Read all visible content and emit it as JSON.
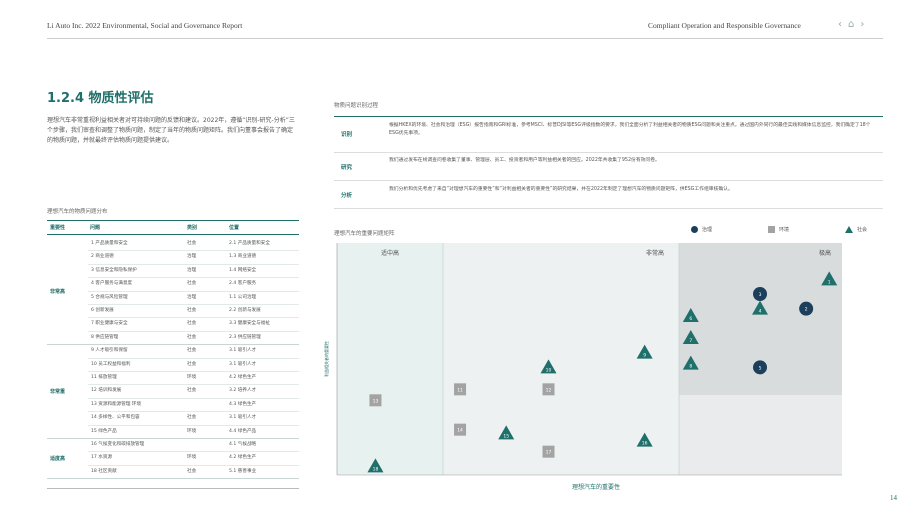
{
  "header": {
    "left": "Li Auto Inc. 2022 Environmental, Social and Governance Report",
    "right": "Compliant Operation and Responsible Governance",
    "nav": {
      "prev": "‹",
      "home": "⌂",
      "next": "›"
    }
  },
  "section": {
    "title": "1.2.4 物质性评估",
    "intro": "理想汽车非常重视利益相关者对可持续问题的反馈和建议。2022年，遵循“识别-研究-分析”三个步骤，我们审查和调整了物质问题，制定了当年的物质问题矩阵。我们向董事会报告了确定的物质问题，并就最终评估物质问题提供建议。"
  },
  "materiality_table": {
    "caption": "理想汽车的物质问题分布",
    "headers": [
      "重要性",
      "问题",
      "类别",
      "位置"
    ],
    "groups": [
      {
        "label": "非常高",
        "rows": [
          [
            "1  产品质量和安全",
            "社会",
            "2.1  产品质量和安全"
          ],
          [
            "2  商业道德",
            "治理",
            "1.3  商业道德"
          ],
          [
            "3  信息安全和隐私保护",
            "治理",
            "1.4  网络安全"
          ],
          [
            "4 客户服务与满意度",
            "社会",
            "2.4 客户服务"
          ],
          [
            "5 合规与风险管理",
            "治理",
            "1.1  公司治理"
          ],
          [
            "6  创新发展",
            "社会",
            "2.2  创新与发展"
          ],
          [
            "7 职业健康与安全",
            "社会",
            "3.3  健康安全与福祉"
          ],
          [
            "8  供应链管理",
            "社会",
            "2.3  供应链管理"
          ]
        ]
      },
      {
        "label": "非常重",
        "rows": [
          [
            "9  人才吸引和保留",
            "社会",
            "3.1  吸引人才"
          ],
          [
            "10 员工权益和福利",
            "社会",
            "3.1  吸引人才"
          ],
          [
            "11 排放管理",
            "环境",
            "4.2  绿色生产"
          ],
          [
            "12 培训和发展",
            "社会",
            "3.2  培养人才"
          ],
          [
            "13 资源和能源管理 环境",
            "",
            "4.3 绿色生产"
          ],
          [
            "14 多样性、公平和包容",
            "社会",
            "3.1  吸引人才"
          ],
          [
            "15 绿色产品",
            "环境",
            "4.4  绿色产品"
          ]
        ]
      },
      {
        "label": "适度高",
        "rows": [
          [
            "16 气候变化和碳排放管理",
            "",
            "4.1  气候战略"
          ],
          [
            "17 水资源",
            "环境",
            "4.2  绿色生产"
          ],
          [
            "18 社区贡献",
            "社会",
            "5.1  慈善事业"
          ]
        ]
      }
    ]
  },
  "process": {
    "title": "物质问题识别过程",
    "steps": [
      {
        "label": "识别",
        "text": "根据HKEX的环境、社会和治理（ESG）报告指南和GRI标准，参考MSCI、标普DJSI等ESG评级指数的要求，我们全面分析了利益相关者的物质ESG问题和关注重点。通过国内外同行的最佳实践和媒体信息监控，我们确定了18个ESG优先事项。"
      },
      {
        "label": "研究",
        "text": "我们通过发布在线调查问卷收集了董事、管理层、员工、投资者和用户等利益相关者的回应。2022年共收集了952份有效问卷。"
      },
      {
        "label": "分析",
        "text": "我们分析和优先考虑了来自“对理想汽车的重要性”和“对利益相关者的重要性”的研究结果，并在2022年制定了理想汽车的物质问题矩阵，供ESG工作组审核确认。"
      }
    ]
  },
  "chart_data": {
    "type": "scatter",
    "title": "理想汽车的重要问题矩阵",
    "xlabel": "理想汽车的重要性",
    "ylabel": "利益相关者的重要性",
    "zones": [
      "适中高",
      "非常高",
      "极高"
    ],
    "legend": [
      {
        "name": "治理",
        "shape": "circle"
      },
      {
        "name": "环境",
        "shape": "square"
      },
      {
        "name": "社会",
        "shape": "triangle"
      }
    ],
    "colors": {
      "governance": "#1c3f5c",
      "environment": "#a3a3a3",
      "social": "#1f6f6a"
    },
    "points": [
      {
        "id": "1",
        "cat": "social",
        "x": 9.6,
        "y": 9.6
      },
      {
        "id": "2",
        "cat": "governance",
        "x": 9.3,
        "y": 9.2
      },
      {
        "id": "3",
        "cat": "governance",
        "x": 8.7,
        "y": 9.4
      },
      {
        "id": "4",
        "cat": "social",
        "x": 8.7,
        "y": 9.2
      },
      {
        "id": "5",
        "cat": "governance",
        "x": 8.7,
        "y": 8.4
      },
      {
        "id": "6",
        "cat": "social",
        "x": 7.8,
        "y": 9.1
      },
      {
        "id": "7",
        "cat": "social",
        "x": 7.8,
        "y": 8.8
      },
      {
        "id": "8",
        "cat": "social",
        "x": 7.8,
        "y": 8.45
      },
      {
        "id": "9",
        "cat": "social",
        "x": 7.2,
        "y": 8.6
      },
      {
        "id": "10",
        "cat": "social",
        "x": 5.95,
        "y": 8.4
      },
      {
        "id": "11",
        "cat": "environment",
        "x": 4.8,
        "y": 8.1
      },
      {
        "id": "12",
        "cat": "environment",
        "x": 5.95,
        "y": 8.1
      },
      {
        "id": "13",
        "cat": "environment",
        "x": 3.7,
        "y": 7.95
      },
      {
        "id": "14",
        "cat": "environment",
        "x": 4.8,
        "y": 7.55
      },
      {
        "id": "15",
        "cat": "social",
        "x": 5.4,
        "y": 7.5
      },
      {
        "id": "16",
        "cat": "social",
        "x": 7.2,
        "y": 7.4
      },
      {
        "id": "17",
        "cat": "environment",
        "x": 5.95,
        "y": 7.25
      },
      {
        "id": "18",
        "cat": "social",
        "x": 3.7,
        "y": 7.05
      }
    ],
    "xlim": [
      3.2,
      10
    ],
    "ylim": [
      7.0,
      10
    ]
  },
  "page": {
    "number": "14"
  }
}
